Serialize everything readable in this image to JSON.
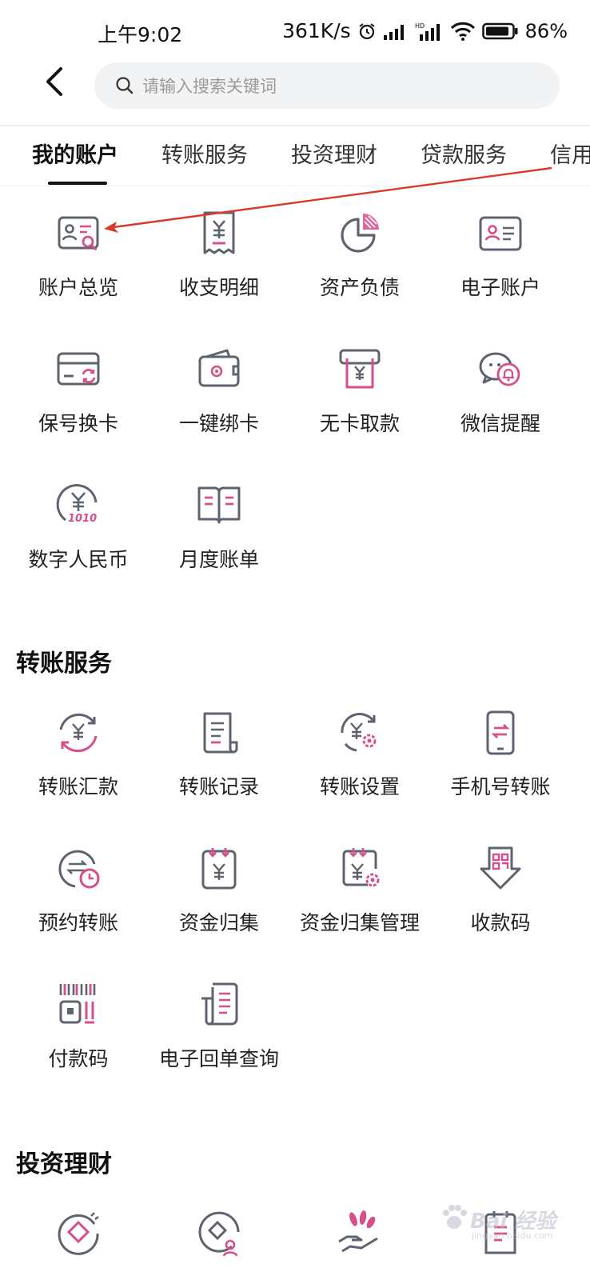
{
  "status_bar": {
    "time": "上午9:02",
    "network_speed": "361K/s",
    "battery": "86%"
  },
  "header": {
    "back_icon": "chevron-left-icon",
    "search_placeholder": "请输入搜索关键词"
  },
  "tabs": [
    {
      "label": "我的账户",
      "active": true
    },
    {
      "label": "转账服务",
      "active": false
    },
    {
      "label": "投资理财",
      "active": false
    },
    {
      "label": "贷款服务",
      "active": false
    },
    {
      "label": "信用",
      "active": false
    }
  ],
  "my_account": {
    "items": [
      {
        "label": "账户总览",
        "icon": "account-overview-icon"
      },
      {
        "label": "收支明细",
        "icon": "receipt-icon"
      },
      {
        "label": "资产负债",
        "icon": "pie-chart-icon"
      },
      {
        "label": "电子账户",
        "icon": "id-card-icon"
      },
      {
        "label": "保号换卡",
        "icon": "card-swap-icon"
      },
      {
        "label": "一键绑卡",
        "icon": "wallet-icon"
      },
      {
        "label": "无卡取款",
        "icon": "atm-withdraw-icon"
      },
      {
        "label": "微信提醒",
        "icon": "wechat-bell-icon"
      },
      {
        "label": "数字人民币",
        "icon": "digital-rmb-icon"
      },
      {
        "label": "月度账单",
        "icon": "book-icon"
      }
    ]
  },
  "transfer": {
    "title": "转账服务",
    "items": [
      {
        "label": "转账汇款",
        "icon": "transfer-cycle-icon"
      },
      {
        "label": "转账记录",
        "icon": "scroll-record-icon"
      },
      {
        "label": "转账设置",
        "icon": "transfer-settings-icon"
      },
      {
        "label": "手机号转账",
        "icon": "phone-transfer-icon"
      },
      {
        "label": "预约转账",
        "icon": "scheduled-transfer-icon"
      },
      {
        "label": "资金归集",
        "icon": "fund-pool-icon"
      },
      {
        "label": "资金归集管理",
        "icon": "fund-pool-settings-icon"
      },
      {
        "label": "收款码",
        "icon": "receive-qr-icon"
      },
      {
        "label": "付款码",
        "icon": "pay-code-icon"
      },
      {
        "label": "电子回单查询",
        "icon": "receipt-query-icon"
      }
    ]
  },
  "investment": {
    "title": "投资理财",
    "icons": [
      "diamond-coin-icon",
      "diamond-user-icon",
      "hand-coin-icon",
      "document-icon"
    ]
  },
  "watermark": {
    "text": "Bai 经验",
    "sub": "jingyan.baidu.com"
  },
  "colors": {
    "icon_gray": "#5d6470",
    "icon_accent": "#d84d8b",
    "annotation_red": "#d9392b"
  }
}
